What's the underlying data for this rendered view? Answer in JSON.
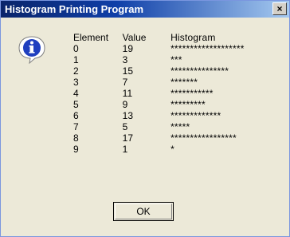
{
  "window": {
    "title": "Histogram Printing Program",
    "close_label": "×"
  },
  "icon": "info-icon",
  "table": {
    "headers": [
      "Element",
      "Value",
      "Histogram"
    ],
    "rows": [
      {
        "element": "0",
        "value": "19",
        "bar": "*******************"
      },
      {
        "element": "1",
        "value": "3",
        "bar": "***"
      },
      {
        "element": "2",
        "value": "15",
        "bar": "***************"
      },
      {
        "element": "3",
        "value": "7",
        "bar": "*******"
      },
      {
        "element": "4",
        "value": "11",
        "bar": "***********"
      },
      {
        "element": "5",
        "value": "9",
        "bar": "*********"
      },
      {
        "element": "6",
        "value": "13",
        "bar": "*************"
      },
      {
        "element": "7",
        "value": "5",
        "bar": "*****"
      },
      {
        "element": "8",
        "value": "17",
        "bar": "*****************"
      },
      {
        "element": "9",
        "value": "1",
        "bar": "*"
      }
    ]
  },
  "buttons": {
    "ok_label": "OK"
  },
  "colors": {
    "title_bar_start": "#0a246a",
    "title_bar_end": "#a6caf0",
    "dialog_bg": "#ece9d8",
    "icon_blue": "#1f3fbf"
  }
}
